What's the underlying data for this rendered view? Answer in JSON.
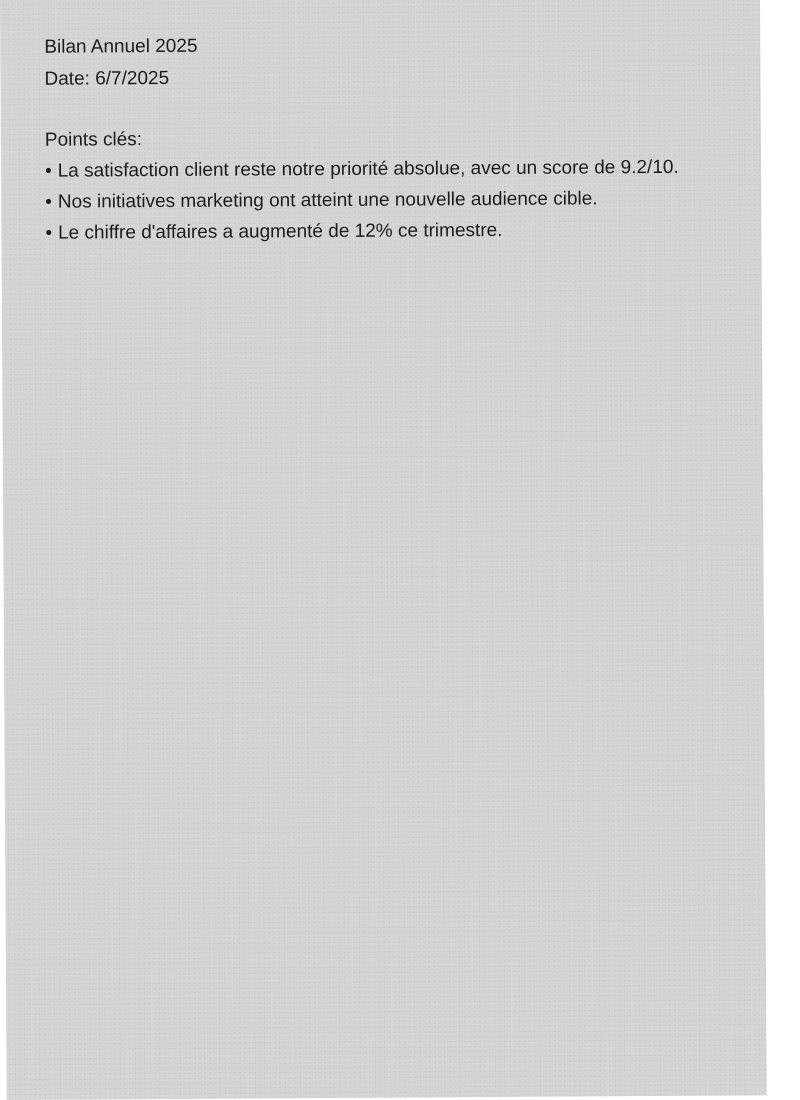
{
  "document": {
    "title": "Bilan Annuel 2025",
    "date": "Date: 6/7/2025",
    "section_label": "Points clés:",
    "bullet_symbol": "•",
    "points": [
      "La satisfaction client reste notre priorité absolue, avec un score de 9.2/10.",
      "Nos initiatives marketing ont atteint une nouvelle audience cible.",
      "Le chiffre d'affaires a augmenté de 12% ce trimestre."
    ]
  },
  "colors": {
    "paper": "#d3d3d3",
    "background": "#ffffff",
    "text": "#1c1c1c"
  }
}
